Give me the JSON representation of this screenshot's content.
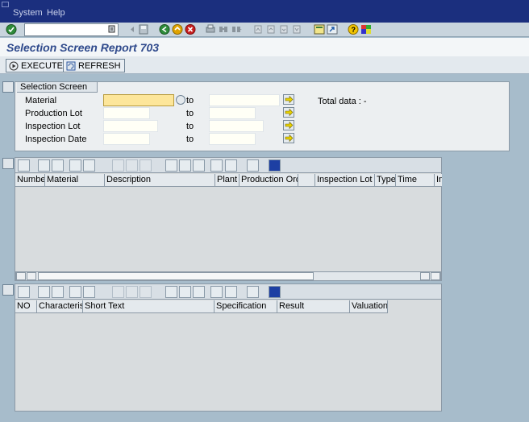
{
  "menu": {
    "items": [
      "System",
      "Help"
    ]
  },
  "toolbar": {
    "command_value": ""
  },
  "page": {
    "title": "Selection Screen Report 703"
  },
  "actions": {
    "execute_label": "EXECUTE",
    "refresh_label": "REFRESH"
  },
  "selection": {
    "tab_label": "Selection Screen",
    "to_label": "to",
    "total_label": "Total data : -",
    "rows": [
      {
        "label": "Material",
        "from": "",
        "to": ""
      },
      {
        "label": "Production Lot",
        "from": "",
        "to": ""
      },
      {
        "label": "Inspection Lot",
        "from": "",
        "to": ""
      },
      {
        "label": "Inspection Date",
        "from": "",
        "to": ""
      }
    ]
  },
  "grid1": {
    "columns": [
      "Number",
      "Material",
      "Description",
      "Plant",
      "Production Order",
      "",
      "Inspection Lot",
      "Type",
      "Time",
      "In"
    ]
  },
  "grid2": {
    "columns": [
      "NO",
      "Characteris...",
      "Short Text",
      "Specification",
      "Result",
      "Valuation"
    ]
  },
  "colors": {
    "menubar": "#1b2f7e",
    "title": "#2f4a8c",
    "background": "#a7bccb",
    "focus_field": "#fde69a"
  }
}
